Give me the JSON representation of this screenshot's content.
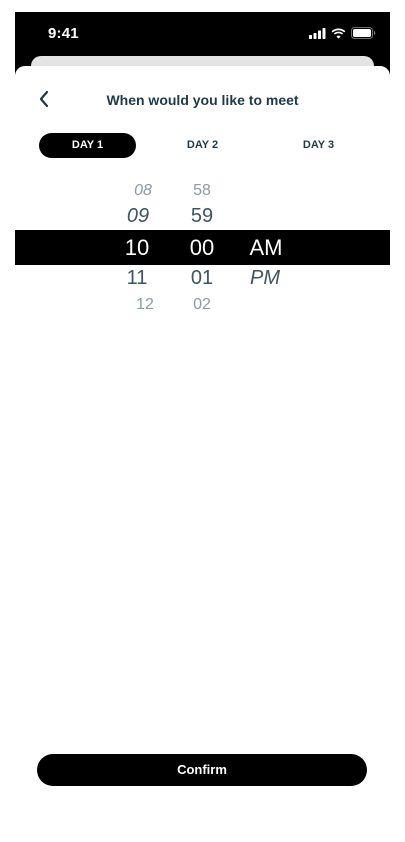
{
  "status_bar": {
    "time": "9:41",
    "icons": [
      "cellular-signal-icon",
      "wifi-icon",
      "battery-icon"
    ]
  },
  "header": {
    "back_icon": "chevron-left-icon",
    "title": "When would you like to meet"
  },
  "day_tabs": [
    {
      "label": "DAY 1",
      "selected": true
    },
    {
      "label": "DAY 2",
      "selected": false
    },
    {
      "label": "DAY 3",
      "selected": false
    }
  ],
  "time_picker": {
    "hours": [
      "08",
      "09",
      "10",
      "11",
      "12"
    ],
    "minutes": [
      "58",
      "59",
      "00",
      "01",
      "02"
    ],
    "periods": [
      "AM",
      "PM"
    ],
    "selected": {
      "hour": "10",
      "minute": "00",
      "period": "AM"
    }
  },
  "confirm_label": "Confirm",
  "colors": {
    "accent": "#000000",
    "title_text": "#1d3a4a",
    "picker_near": "#3c5563",
    "picker_far": "#8a9aa4"
  }
}
